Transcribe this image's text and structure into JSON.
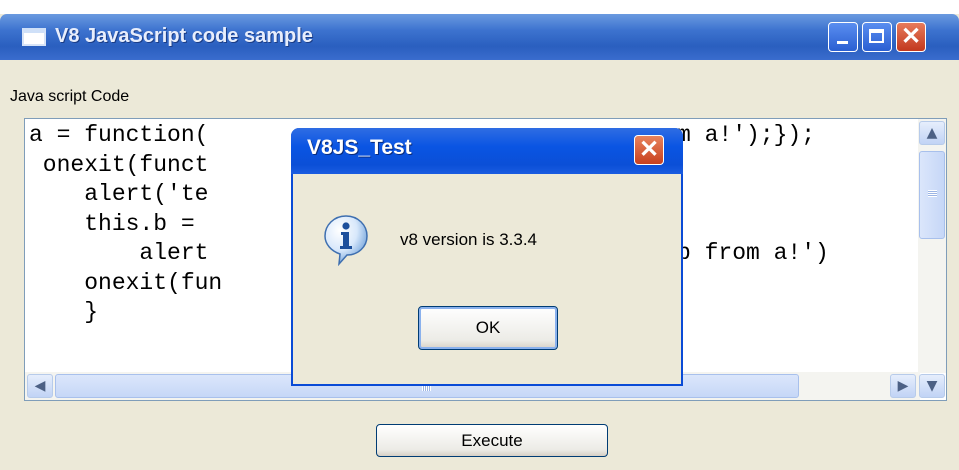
{
  "window": {
    "title": "V8 JavaScript code sample",
    "code_label": "Java script Code",
    "code_lines": "a = function(\n onexit(funct\n    alert('te\n    this.b = \n        alert\n    onexit(fun\n    }",
    "code_lines_right": "m a!');});\n\n\n\nb from a!')",
    "execute_label": "Execute"
  },
  "dialog": {
    "title": "V8JS_Test",
    "message": "v8 version is 3.3.4",
    "ok_label": "OK",
    "close_glyph": "✕"
  },
  "colors": {
    "titlebar": "#2a5fbf",
    "dialog_titlebar": "#0a55e3",
    "window_bg": "#ece9d8",
    "close_red": "#c8401e"
  }
}
